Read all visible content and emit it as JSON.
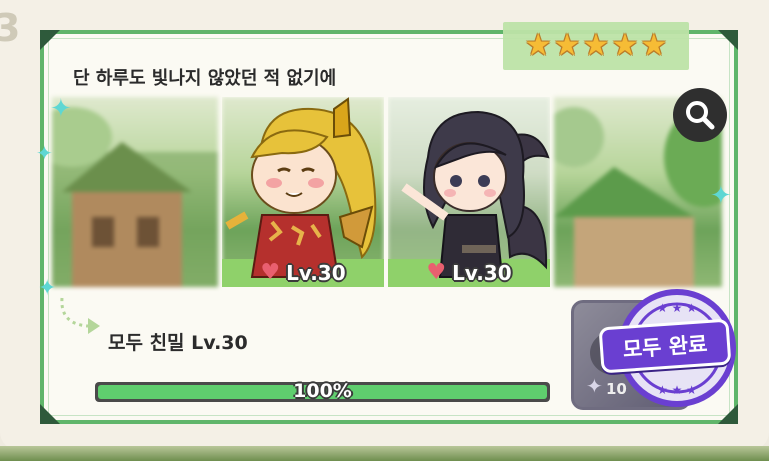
{
  "edge_number": "3",
  "card": {
    "rating_stars": 5,
    "title": "단 하루도 빛나지 않았던 적 없기에",
    "characters": [
      {
        "level_label": "Lv.30"
      },
      {
        "level_label": "Lv.30"
      }
    ],
    "mission_text": "모두 친밀 Lv.30",
    "progress": {
      "percent": 100,
      "label": "100%"
    },
    "reward": {
      "count_label": "10"
    },
    "complete_stamp": "모두 완료"
  },
  "colors": {
    "frame_green": "#5fb56a",
    "progress_green": "#5fce6e",
    "heart": "#e95f6f",
    "stamp_purple": "#6a3fd1",
    "star_gold": "#f6b92b"
  },
  "icons": {
    "search": "magnifier-icon",
    "heart": "heart-icon",
    "star": "star-icon",
    "sparkle": "sparkle-icon"
  }
}
